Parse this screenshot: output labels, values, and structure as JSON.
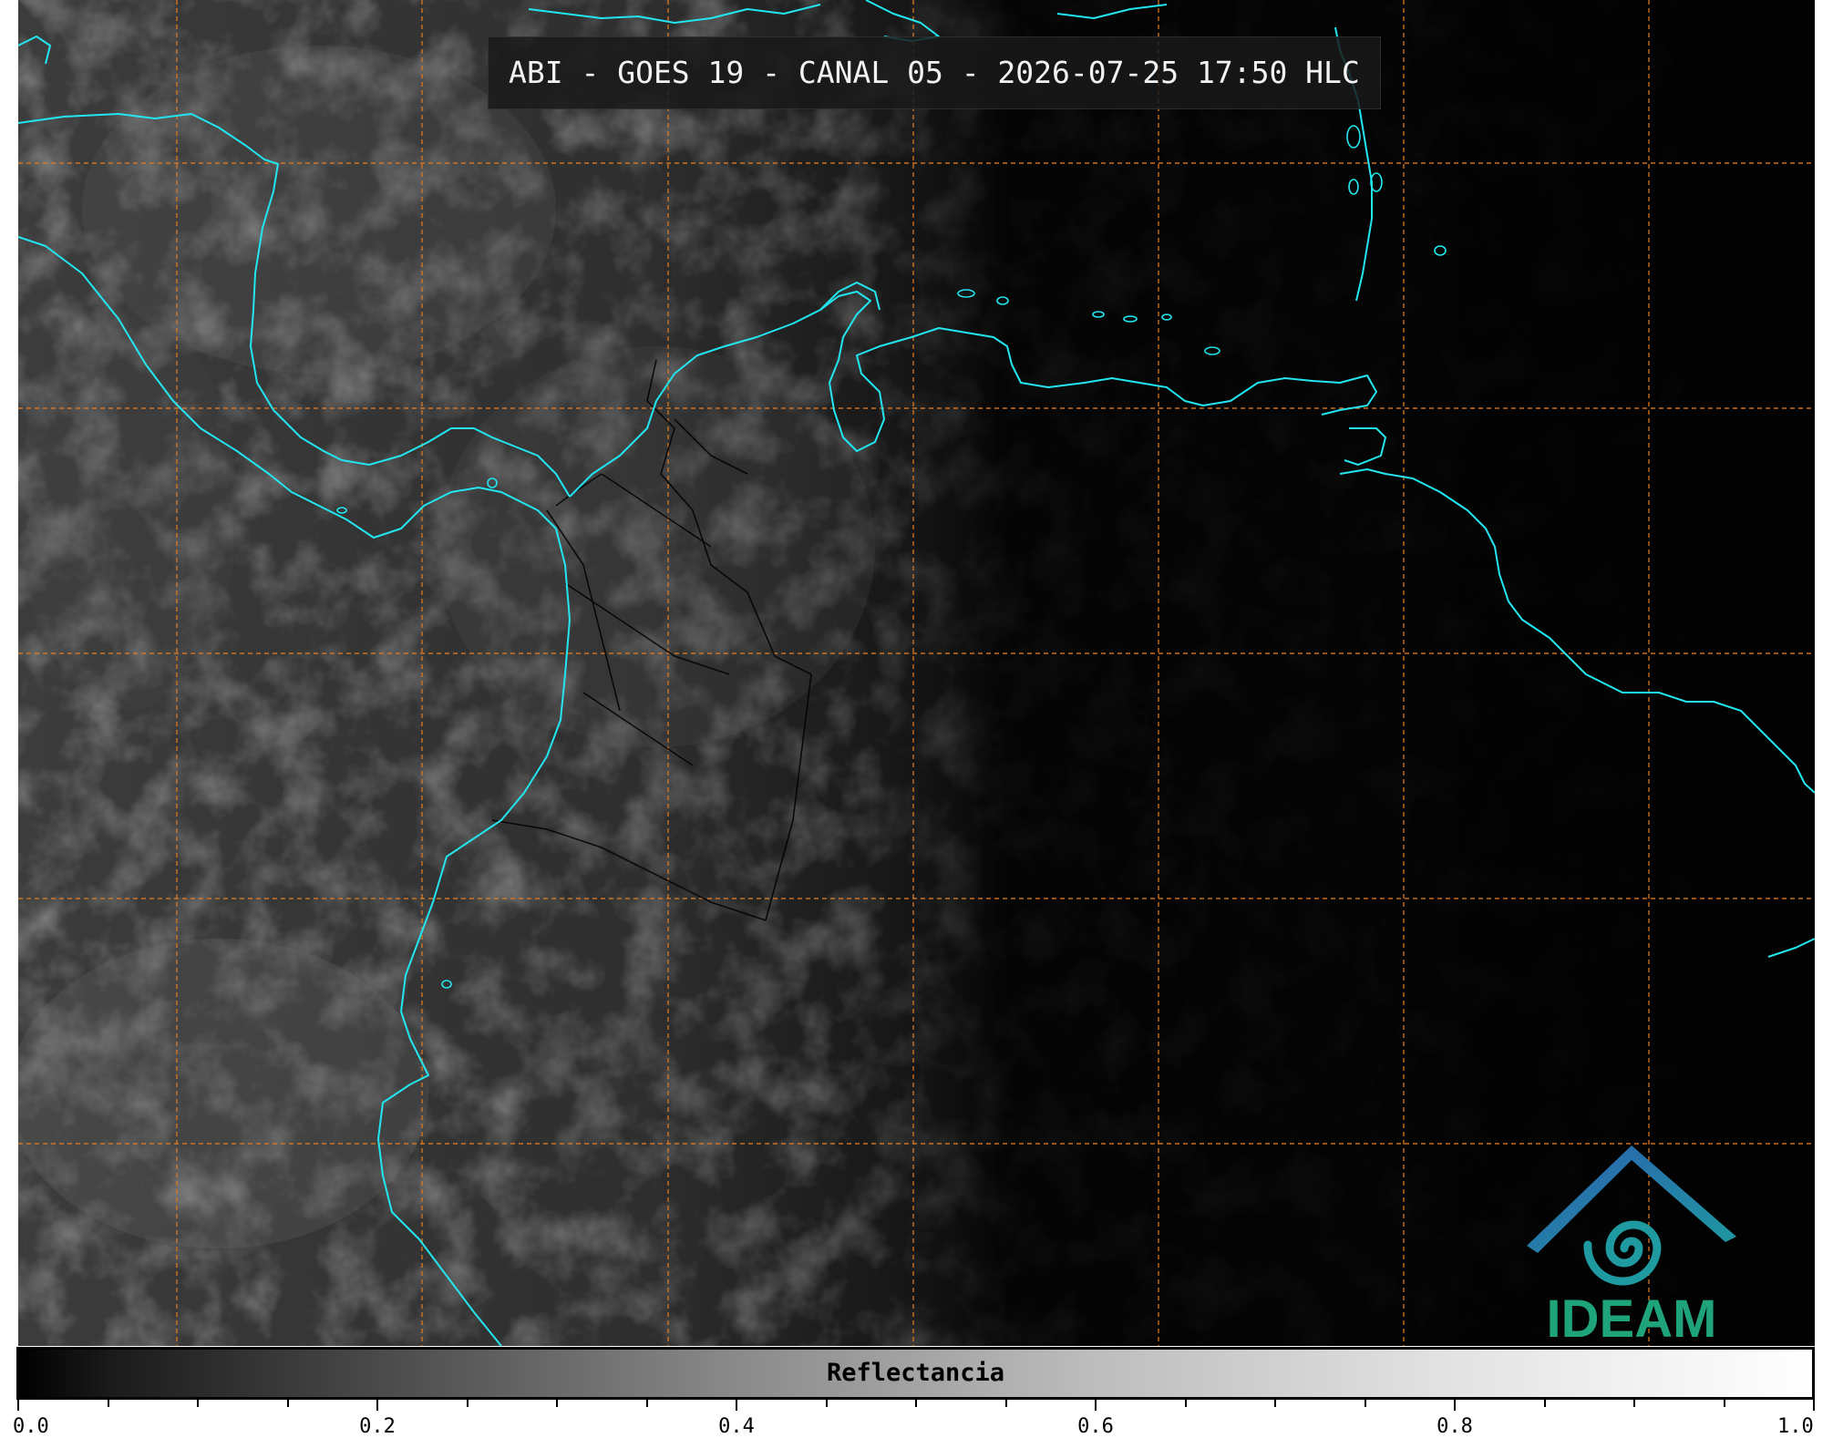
{
  "title": "ABI - GOES 19 - CANAL 05 - 2026-07-25 17:50 HLC",
  "colorbar": {
    "label": "Reflectancia",
    "min": 0.0,
    "max": 1.0,
    "ticks": [
      {
        "value": 0.0,
        "label": "0.0"
      },
      {
        "value": 0.2,
        "label": "0.2"
      },
      {
        "value": 0.4,
        "label": "0.4"
      },
      {
        "value": 0.6,
        "label": "0.6"
      },
      {
        "value": 0.8,
        "label": "0.8"
      },
      {
        "value": 1.0,
        "label": "1.0"
      }
    ],
    "minor_step": 0.05,
    "colormap": [
      "#000000",
      "#ffffff"
    ]
  },
  "map": {
    "coastline_color": "#22e6f0",
    "border_color": "#000000",
    "gridline_color": "#e07a20"
  },
  "logo": {
    "text": "IDEAM",
    "text_color": "#1fa37a",
    "roof_color": "#2b5fb0",
    "swirl_color": "#1f9aa0"
  }
}
